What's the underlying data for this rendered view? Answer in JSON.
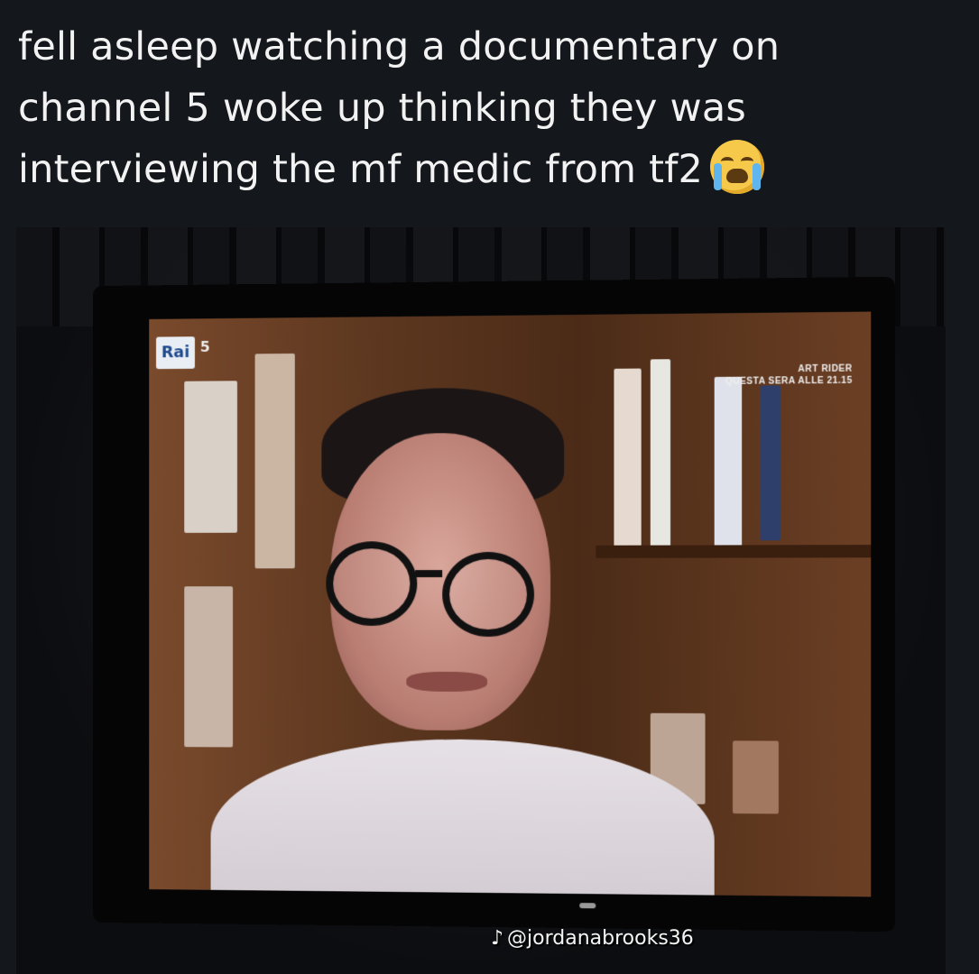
{
  "caption": {
    "line1": "fell asleep watching a documentary on",
    "line2": "channel 5 woke up thinking they was",
    "line3": "interviewing the mf medic from tf2"
  },
  "emoji": "loudly-crying-face-icon",
  "tv": {
    "channel_logo": "Rai",
    "channel_number": "5",
    "promo_line1": "ART RIDER",
    "promo_line2": "QUESTA SERA ALLE 21.15"
  },
  "watermark": {
    "icon": "tiktok-icon",
    "handle": "@jordanabrooks36"
  }
}
